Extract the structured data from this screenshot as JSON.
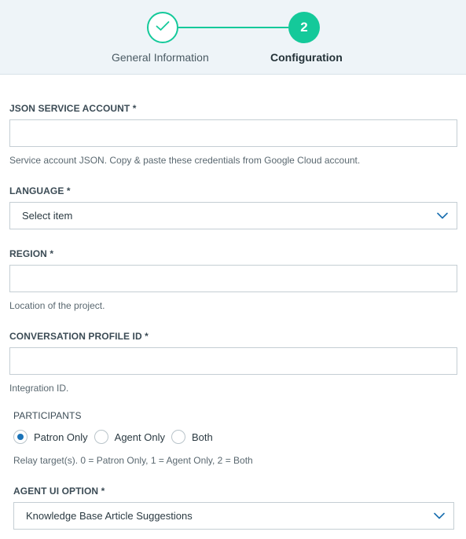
{
  "stepper": {
    "step1": {
      "label": "General Information",
      "state": "completed",
      "icon": "check-icon"
    },
    "step2": {
      "number": "2",
      "label": "Configuration",
      "state": "active"
    },
    "accent_color": "#14c99a"
  },
  "form": {
    "json_service_account": {
      "label": "JSON SERVICE ACCOUNT *",
      "value": "",
      "help": "Service account JSON. Copy & paste these credentials from Google Cloud account."
    },
    "language": {
      "label": "LANGUAGE *",
      "selected": "Select item",
      "icon": "chevron-down-icon"
    },
    "region": {
      "label": "REGION *",
      "value": "",
      "help": "Location of the project."
    },
    "conversation_profile_id": {
      "label": "CONVERSATION PROFILE ID *",
      "value": "",
      "help": "Integration ID."
    },
    "participants": {
      "label": "PARTICIPANTS",
      "options": [
        {
          "label": "Patron Only",
          "checked": true
        },
        {
          "label": "Agent Only",
          "checked": false
        },
        {
          "label": "Both",
          "checked": false
        }
      ],
      "help": "Relay target(s). 0 = Patron Only, 1 = Agent Only, 2 = Both"
    },
    "agent_ui_option": {
      "label": "AGENT UI OPTION *",
      "selected": "Knowledge Base Article Suggestions",
      "icon": "chevron-down-icon"
    }
  }
}
